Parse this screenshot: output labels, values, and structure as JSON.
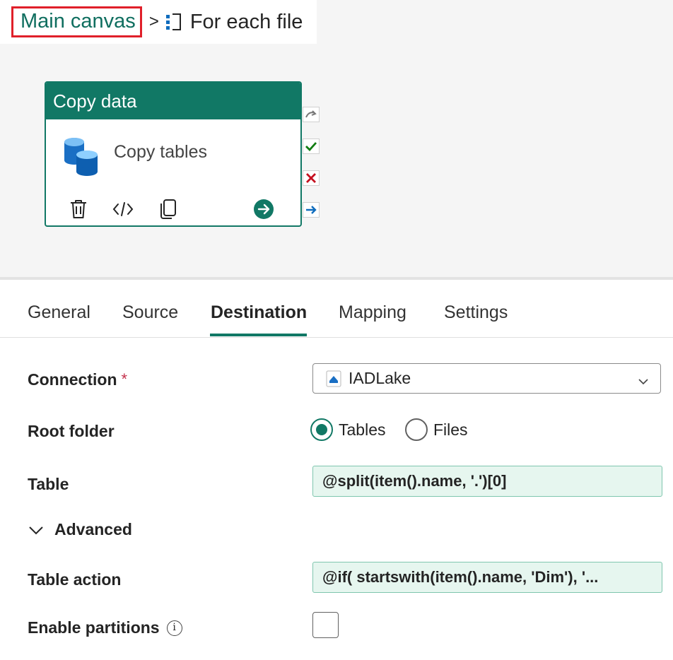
{
  "breadcrumb": {
    "root": "Main canvas",
    "separator": ">",
    "current": "For each file",
    "current_icon": "foreach-icon"
  },
  "activity": {
    "type": "Copy data",
    "name": "Copy tables",
    "icon": "database-icon",
    "tools": [
      "delete-icon",
      "code-icon",
      "copy-icon",
      "go-arrow-icon"
    ],
    "connectors": [
      "skip-connector",
      "success-connector",
      "fail-connector",
      "completion-connector"
    ]
  },
  "tabs": [
    {
      "label": "General"
    },
    {
      "label": "Source"
    },
    {
      "label": "Destination",
      "active": true
    },
    {
      "label": "Mapping"
    },
    {
      "label": "Settings"
    }
  ],
  "form": {
    "connection": {
      "label": "Connection",
      "required_mark": "*",
      "value": "IADLake"
    },
    "root_folder": {
      "label": "Root folder",
      "options": [
        "Tables",
        "Files"
      ],
      "selected": "Tables"
    },
    "table": {
      "label": "Table",
      "value": "@split(item().name, '.')[0]"
    },
    "advanced": {
      "label": "Advanced",
      "expanded": true
    },
    "table_action": {
      "label": "Table action",
      "value": "@if( startswith(item().name, 'Dim'), '..."
    },
    "enable_partitions": {
      "label": "Enable partitions",
      "checked": false
    }
  },
  "colors": {
    "accent": "#117865",
    "highlight_box": "#e0202a",
    "expression_bg": "#e6f6ef",
    "success": "#107c10",
    "fail": "#c50f1f",
    "completion": "#0f6cbd"
  }
}
